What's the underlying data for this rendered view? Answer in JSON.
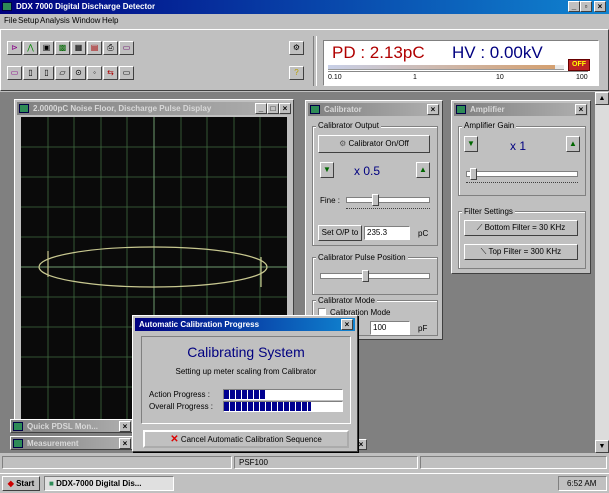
{
  "app": {
    "title": "DDX 7000 Digital Discharge Detector",
    "menu": [
      "File",
      "Setup",
      "Analysis",
      "Window",
      "Help"
    ]
  },
  "readout": {
    "pd": "PD : 2.13pC",
    "hv": "HV : 0.00kV",
    "hv_badge": "OFF",
    "scale_ticks": [
      "0.10",
      "1",
      "10",
      "100"
    ]
  },
  "scope_window": {
    "title": "2.0000pC Noise Floor, Discharge Pulse Display"
  },
  "calibrator": {
    "title": "Calibrator",
    "output_group": "Calibrator Output",
    "onoff_button": "Calibrator On/Off",
    "multiplier": "x 0.5",
    "fine_label": "Fine :",
    "setop_button": "Set O/P to",
    "setop_value": "235.3",
    "setop_unit": "pC",
    "pulse_position_group": "Calibrator Pulse Position",
    "mode_group": "Calibrator Mode",
    "mode_option": "Calibration Mode",
    "cap_value": "100",
    "cap_unit": "pF"
  },
  "amplifier": {
    "title": "Amplifier",
    "gain_group": "Amplifier Gain",
    "gain_value": "x 1",
    "filter_group": "Filter Settings",
    "bottom_filter": "Bottom Filter = 30 KHz",
    "top_filter": "Top Filter = 300 KHz"
  },
  "minimized": {
    "quick": "Quick PDSL Mon...",
    "measurement": "Measurement"
  },
  "dialog": {
    "title": "Automatic Calibration Progress",
    "heading": "Calibrating System",
    "subtext": "Setting up meter scaling from Calibrator",
    "action_label": "Action Progress :",
    "overall_label": "Overall Progress :",
    "action_progress": 0.36,
    "overall_progress": 0.74,
    "cancel_button": "Cancel Automatic Calibration Sequence"
  },
  "statusbar": {
    "panel": "PSF100"
  },
  "taskbar": {
    "start": "Start",
    "task": "DDX-7000 Digital Dis...",
    "clock": "6:52 AM"
  }
}
